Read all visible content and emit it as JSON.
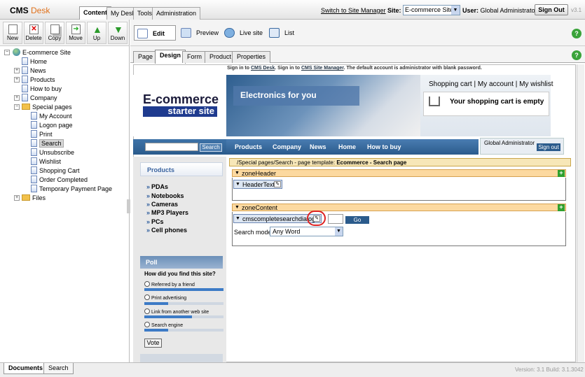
{
  "app": {
    "logo_main": "CMS",
    "logo_accent": "Desk",
    "version": "v3.1"
  },
  "top_tabs": [
    "Content",
    "My Desk",
    "Tools",
    "Administration"
  ],
  "header": {
    "switch_link": "Switch to Site Manager",
    "site_label": "Site:",
    "site_value": "E-commerce Site",
    "user_label": "User:",
    "user_value": "Global Administrator",
    "signout": "Sign Out"
  },
  "toolbar": {
    "new": "New",
    "delete": "Delete",
    "copy": "Copy",
    "move": "Move",
    "up": "Up",
    "down": "Down"
  },
  "modes": {
    "edit": "Edit",
    "preview": "Preview",
    "live": "Live site",
    "list": "List"
  },
  "help": "?",
  "tree": {
    "root": "E-commerce Site",
    "items": [
      "Home",
      "News",
      "Products",
      "How to buy",
      "Company",
      "Special pages",
      "My Account",
      "Logon page",
      "Print",
      "Search",
      "Unsubscribe",
      "Wishlist",
      "Shopping Cart",
      "Order Completed",
      "Temporary Payment Page",
      "Files"
    ]
  },
  "page_tabs": [
    "Page",
    "Design",
    "Form",
    "Product",
    "Properties"
  ],
  "signin": {
    "a": "Sign in to",
    "b": "CMS Desk",
    "c": ". Sign in to",
    "d": "CMS Site Manager",
    "e": ". The default account is administrator with blank password."
  },
  "site": {
    "brand1": "E-commerce",
    "brand2": "starter site",
    "slogan": "Electronics for you",
    "cart_links": "Shopping cart | My account | My wishlist",
    "cart_empty": "Your shopping cart is empty",
    "search_btn": "Search",
    "nav": [
      "Products",
      "Company",
      "News",
      "Home",
      "How to buy"
    ],
    "user": "Global Administrator",
    "signout": "Sign out"
  },
  "products": {
    "title": "Products",
    "items": [
      "PDAs",
      "Notebooks",
      "Cameras",
      "MP3 Players",
      "PCs",
      "Cell phones"
    ]
  },
  "poll": {
    "title": "Poll",
    "question": "How did you find this site?",
    "options": [
      "Referred by a friend",
      "Print advertising",
      "Link from another web site",
      "Search engine"
    ],
    "vote": "Vote",
    "levels": [
      1.0,
      0.3,
      0.6,
      0.3
    ]
  },
  "zones": {
    "path_prefix": "/Special pages/Search",
    "path_mid": " - page template: ",
    "path_template": "Ecommerce - Search page",
    "header_zone": "zoneHeader",
    "header_wp": "HeaderText",
    "content_zone": "zoneContent",
    "content_wp": "cmscompletesearchdialog",
    "go": "Go",
    "search_mode_label": "Search mode:",
    "search_mode_value": "Any Word"
  },
  "bottom": {
    "tabs": [
      "Documents",
      "Search"
    ],
    "version": "Version: 3.1 Build: 3.1.3042"
  }
}
